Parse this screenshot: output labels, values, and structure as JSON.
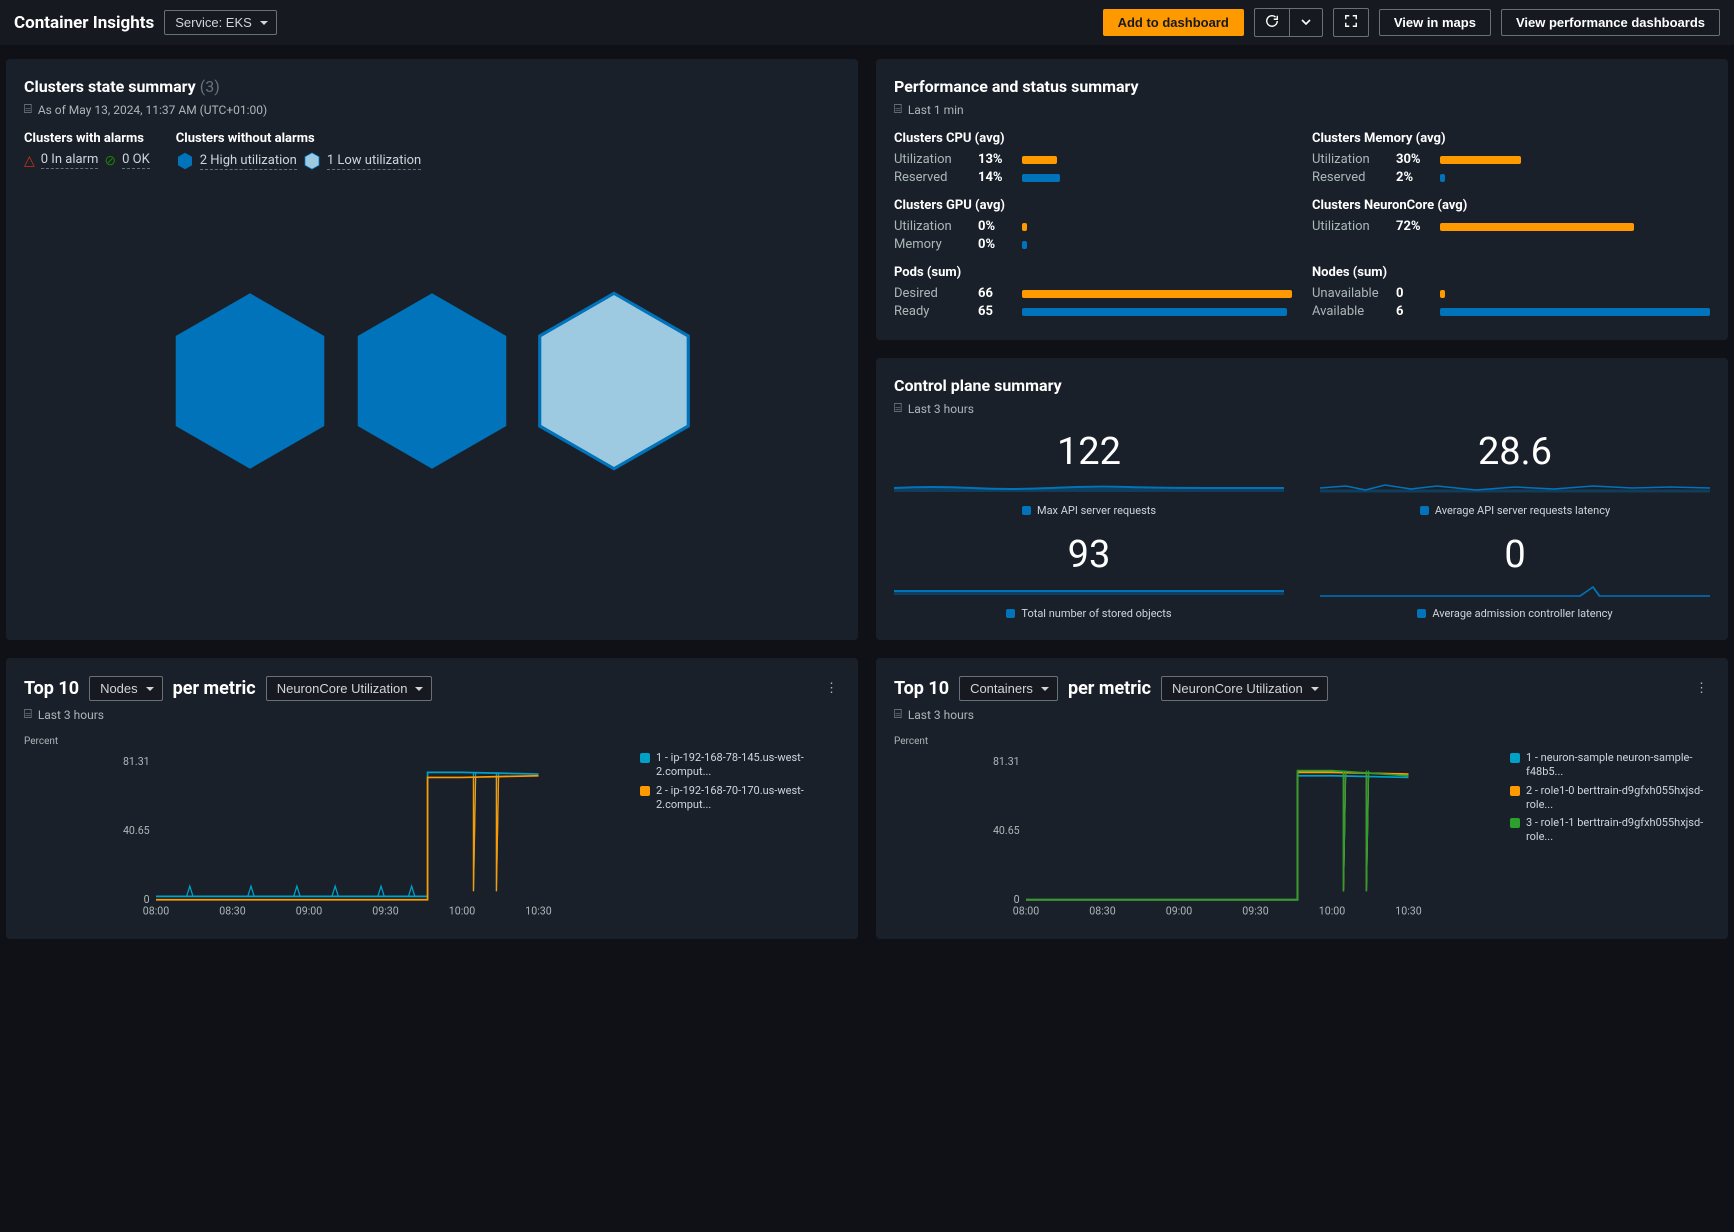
{
  "header": {
    "title": "Container Insights",
    "service_label": "Service: EKS",
    "add_to_dashboard": "Add to dashboard",
    "view_in_maps": "View in maps",
    "view_perf": "View performance dashboards"
  },
  "clusters_state": {
    "title": "Clusters state summary",
    "count": "(3)",
    "as_of": "As of May 13, 2024, 11:37 AM (UTC+01:00)",
    "with_alarms_label": "Clusters with alarms",
    "without_alarms_label": "Clusters without alarms",
    "in_alarm": "0 In alarm",
    "ok": "0 OK",
    "high_util": "2 High utilization",
    "low_util": "1 Low utilization"
  },
  "perf": {
    "title": "Performance and status summary",
    "time": "Last 1 min",
    "cpu": {
      "title": "Clusters CPU (avg)",
      "util_label": "Utilization",
      "util_val": "13%",
      "util_pct": 13,
      "res_label": "Reserved",
      "res_val": "14%",
      "res_pct": 14
    },
    "mem": {
      "title": "Clusters Memory (avg)",
      "util_label": "Utilization",
      "util_val": "30%",
      "util_pct": 30,
      "res_label": "Reserved",
      "res_val": "2%",
      "res_pct": 2
    },
    "gpu": {
      "title": "Clusters GPU (avg)",
      "util_label": "Utilization",
      "util_val": "0%",
      "util_pct": 2,
      "mem_label": "Memory",
      "mem_val": "0%",
      "mem_pct": 2
    },
    "nc": {
      "title": "Clusters NeuronCore (avg)",
      "util_label": "Utilization",
      "util_val": "72%",
      "util_pct": 72
    },
    "pods": {
      "title": "Pods (sum)",
      "desired_label": "Desired",
      "desired_val": "66",
      "desired_pct": 100,
      "ready_label": "Ready",
      "ready_val": "65",
      "ready_pct": 98
    },
    "nodes": {
      "title": "Nodes (sum)",
      "unavail_label": "Unavailable",
      "unavail_val": "0",
      "unavail_pct": 2,
      "avail_label": "Available",
      "avail_val": "6",
      "avail_pct": 100
    }
  },
  "control_plane": {
    "title": "Control plane summary",
    "time": "Last 3 hours",
    "metrics": [
      {
        "value": "122",
        "label": "Max API server requests"
      },
      {
        "value": "28.6",
        "label": "Average API server requests latency"
      },
      {
        "value": "93",
        "label": "Total number of stored objects"
      },
      {
        "value": "0",
        "label": "Average admission controller latency"
      }
    ]
  },
  "top_left": {
    "top_label": "Top 10",
    "dim": "Nodes",
    "per_label": "per metric",
    "metric": "NeuronCore Utilization",
    "time": "Last 3 hours",
    "ylabel": "Percent",
    "legend": [
      {
        "color": "#00a1c9",
        "text": "1 - ip-192-168-78-145.us-west-2.comput..."
      },
      {
        "color": "#ff9900",
        "text": "2 - ip-192-168-70-170.us-west-2.comput..."
      }
    ]
  },
  "top_right": {
    "top_label": "Top 10",
    "dim": "Containers",
    "per_label": "per metric",
    "metric": "NeuronCore Utilization",
    "time": "Last 3 hours",
    "ylabel": "Percent",
    "legend": [
      {
        "color": "#00a1c9",
        "text": "1 - neuron-sample neuron-sample-f48b5..."
      },
      {
        "color": "#ff9900",
        "text": "2 - role1-0 berttrain-d9gfxh055hxjsd-role..."
      },
      {
        "color": "#2ca02c",
        "text": "3 - role1-1 berttrain-d9gfxh055hxjsd-role..."
      }
    ]
  },
  "chart_data": [
    {
      "type": "line",
      "title": "Top 10 Nodes per metric NeuronCore Utilization",
      "xlabel": "",
      "ylabel": "Percent",
      "ylim": [
        0,
        81.31
      ],
      "x": [
        "08:00",
        "08:30",
        "09:00",
        "09:30",
        "10:00",
        "10:30"
      ],
      "y_ticks": [
        0,
        40.65,
        81.31
      ],
      "series": [
        {
          "name": "1 - ip-192-168-78-145.us-west-2.compute",
          "color": "#00a1c9",
          "values": [
            2,
            2,
            2,
            2,
            75,
            74
          ]
        },
        {
          "name": "2 - ip-192-168-70-170.us-west-2.compute",
          "color": "#ff9900",
          "values": [
            0,
            0,
            0,
            0,
            72,
            73
          ]
        }
      ]
    },
    {
      "type": "line",
      "title": "Top 10 Containers per metric NeuronCore Utilization",
      "xlabel": "",
      "ylabel": "Percent",
      "ylim": [
        0,
        81.31
      ],
      "x": [
        "08:00",
        "08:30",
        "09:00",
        "09:30",
        "10:00",
        "10:30"
      ],
      "y_ticks": [
        0,
        40.65,
        81.31
      ],
      "series": [
        {
          "name": "1 - neuron-sample neuron-sample-f48b5",
          "color": "#00a1c9",
          "values": [
            0,
            0,
            0,
            0,
            73,
            72
          ]
        },
        {
          "name": "2 - role1-0 berttrain-d9gfxh055hxjsd-role",
          "color": "#ff9900",
          "values": [
            0,
            0,
            0,
            0,
            75,
            74
          ]
        },
        {
          "name": "3 - role1-1 berttrain-d9gfxh055hxjsd-role",
          "color": "#2ca02c",
          "values": [
            0,
            0,
            0,
            0,
            76,
            73
          ]
        }
      ]
    }
  ]
}
